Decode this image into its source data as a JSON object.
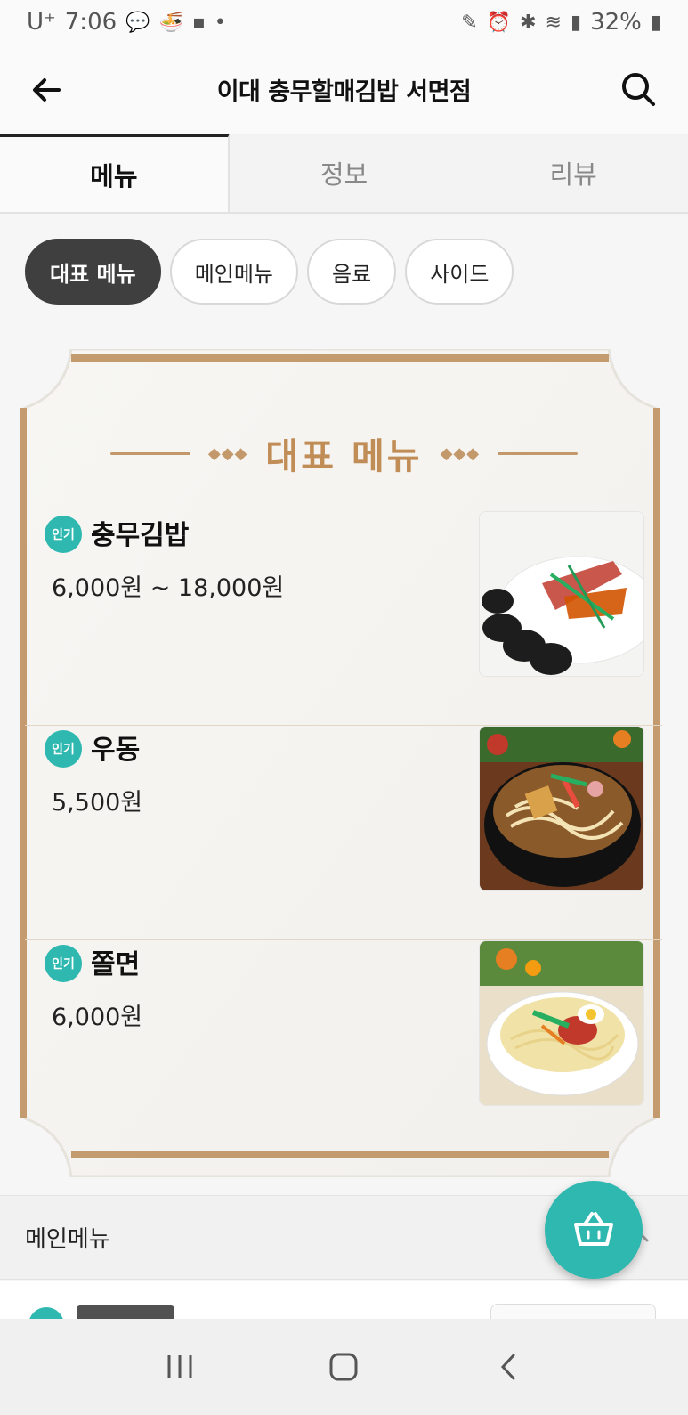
{
  "status_bar": {
    "carrier": "U⁺",
    "time": "7:06",
    "battery": "32%"
  },
  "header": {
    "title": "이대 충무할매김밥 서면점"
  },
  "tabs": [
    {
      "label": "메뉴",
      "active": true
    },
    {
      "label": "정보",
      "active": false
    },
    {
      "label": "리뷰",
      "active": false
    }
  ],
  "chips": [
    {
      "label": "대표 메뉴",
      "active": true
    },
    {
      "label": "메인메뉴",
      "active": false
    },
    {
      "label": "음료",
      "active": false
    },
    {
      "label": "사이드",
      "active": false
    }
  ],
  "featured": {
    "title": "대표 메뉴",
    "items": [
      {
        "badge": "인기",
        "name": "충무김밥",
        "price": "6,000원 ~ 18,000원",
        "image": "gimbap-photo"
      },
      {
        "badge": "인기",
        "name": "우동",
        "price": "5,500원",
        "image": "udon-photo"
      },
      {
        "badge": "인기",
        "name": "쫄면",
        "price": "6,000원",
        "image": "jjolmyeon-photo"
      }
    ]
  },
  "category_section": {
    "title": "메인메뉴"
  },
  "colors": {
    "accent_teal": "#2fb8b0",
    "frame_gold": "#c18d57",
    "chip_active": "#3f3f3f"
  }
}
